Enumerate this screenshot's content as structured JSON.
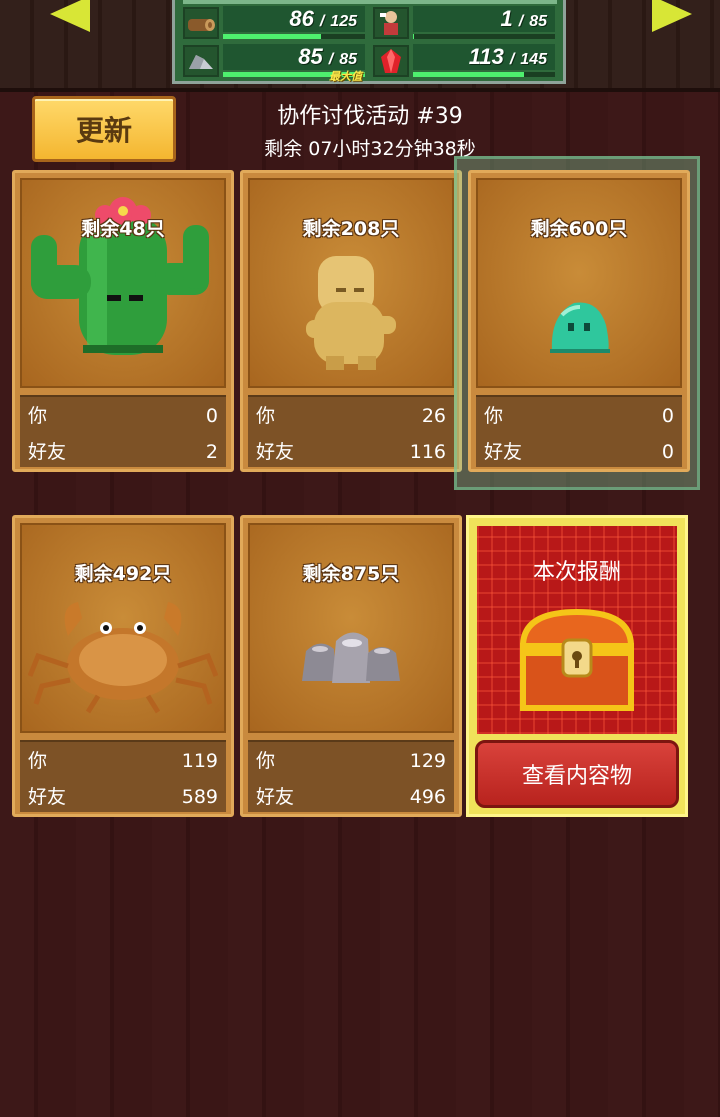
{
  "resources": [
    {
      "icon": "wood-log-icon",
      "value": "86",
      "max": "125",
      "fill": 0.69
    },
    {
      "icon": "worker-icon",
      "value": "1",
      "max": "85",
      "fill": 0.01
    },
    {
      "icon": "ore-stone-icon",
      "value": "85",
      "max": "85",
      "fill": 1.0
    },
    {
      "icon": "red-gem-icon",
      "value": "113",
      "max": "145",
      "fill": 0.78
    }
  ],
  "max_tag": "最大值",
  "refresh_label": "更新",
  "event_title": "协作讨伐活动 #39",
  "event_timer": "剩余 07小时32分钟38秒",
  "labels": {
    "you": "你",
    "friends": "好友"
  },
  "cards": [
    {
      "remain": "剩余48只",
      "monster": "cactus",
      "you": "0",
      "friends": "2"
    },
    {
      "remain": "剩余208只",
      "monster": "ginger-root",
      "you": "26",
      "friends": "116"
    },
    {
      "remain": "剩余600只",
      "monster": "green-slime",
      "you": "0",
      "friends": "0"
    },
    {
      "remain": "剩余492只",
      "monster": "crab",
      "you": "119",
      "friends": "589"
    },
    {
      "remain": "剩余875只",
      "monster": "rocks",
      "you": "129",
      "friends": "496"
    }
  ],
  "reward": {
    "title": "本次报酬",
    "button": "查看内容物",
    "icon": "treasure-chest-icon"
  },
  "colors": {
    "bar_fill": "#4ef06e",
    "accent_yellow": "#f4b630",
    "reward_red": "#b81818"
  }
}
